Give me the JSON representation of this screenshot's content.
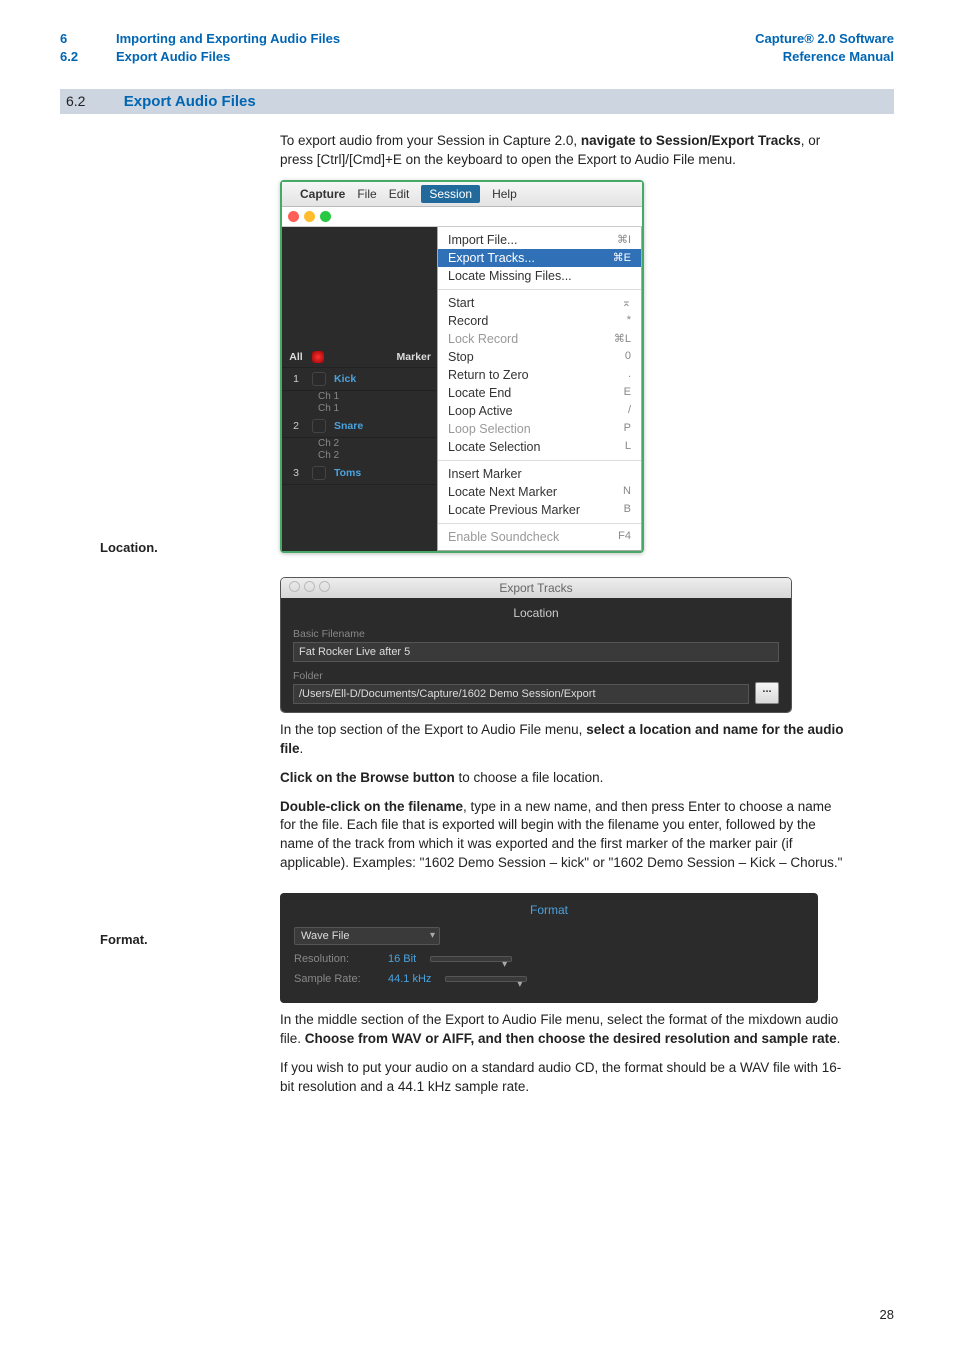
{
  "header": {
    "left_num1": "6",
    "left_title1": "Importing and Exporting Audio Files",
    "left_num2": "6.2",
    "left_title2": "Export Audio Files",
    "right1": "Capture® 2.0 Software",
    "right2": "Reference Manual"
  },
  "section": {
    "num": "6.2",
    "title": "Export Audio Files"
  },
  "intro": {
    "part1": "To export audio from your Session in Capture 2.0, ",
    "bold1": "navigate to Session/Export Tracks",
    "part2": ", or press [Ctrl]/[Cmd]+E on the keyboard to open the Export to Audio File menu."
  },
  "menu": {
    "menubar": {
      "apple": "",
      "app": "Capture",
      "file": "File",
      "edit": "Edit",
      "session": "Session",
      "help": "Help"
    },
    "tracks": {
      "allLabel": "All",
      "markerLabel": "Marker",
      "rows": [
        {
          "num": "1",
          "name": "Kick",
          "subA": "Ch 1",
          "subB": "Ch 1"
        },
        {
          "num": "2",
          "name": "Snare",
          "subA": "Ch 2",
          "subB": "Ch 2"
        },
        {
          "num": "3",
          "name": "Toms"
        }
      ]
    },
    "items": [
      {
        "label": "Import File...",
        "kb": "⌘I"
      },
      {
        "label": "Export Tracks...",
        "kb": "⌘E",
        "hl": true
      },
      {
        "label": "Locate Missing Files...",
        "kb": ""
      },
      {
        "sep": true
      },
      {
        "label": "Start",
        "kb": "⌅"
      },
      {
        "label": "Record",
        "kb": "*"
      },
      {
        "label": "Lock Record",
        "kb": "⌘L",
        "disabled": true
      },
      {
        "label": "Stop",
        "kb": "0"
      },
      {
        "label": "Return to Zero",
        "kb": "."
      },
      {
        "label": "Locate End",
        "kb": "E"
      },
      {
        "label": "Loop Active",
        "kb": "/"
      },
      {
        "label": "Loop Selection",
        "kb": "P",
        "disabled": true
      },
      {
        "label": "Locate Selection",
        "kb": "L"
      },
      {
        "sep": true
      },
      {
        "label": "Insert Marker",
        "kb": ""
      },
      {
        "label": "Locate Next Marker",
        "kb": "N"
      },
      {
        "label": "Locate Previous Marker",
        "kb": "B"
      },
      {
        "sep": true
      },
      {
        "label": "Enable Soundcheck",
        "kb": "F4",
        "disabled": true
      }
    ]
  },
  "side_location": "Location.",
  "loc_panel": {
    "wintitle": "Export Tracks",
    "heading": "Location",
    "basic_lbl": "Basic Filename",
    "basic_val": "Fat Rocker Live after 5",
    "folder_lbl": "Folder",
    "folder_val": "/Users/Ell-D/Documents/Capture/1602 Demo Session/Export",
    "browse": "..."
  },
  "loc_text": {
    "p1a": "In the top section of the Export to Audio File menu, ",
    "p1b": "select a location and name for the audio file",
    "p1c": ".",
    "p2a": "Click on the Browse button",
    "p2b": " to choose a file location.",
    "p3a": "Double-click on the filename",
    "p3b": ", type in a new name, and then press Enter to choose a name for the file. Each file that is exported will begin with the filename you enter, followed by the name of the track from which it was exported and the first marker of the marker pair (if applicable). Examples: \"1602 Demo Session – kick\" or \"1602 Demo Session – Kick – Chorus.\""
  },
  "side_format": "Format.",
  "fmt_panel": {
    "heading": "Format",
    "file_type": "Wave File",
    "res_lbl": "Resolution:",
    "res_val": "16 Bit",
    "rate_lbl": "Sample Rate:",
    "rate_val": "44.1 kHz"
  },
  "fmt_text": {
    "p1a": "In the middle section of the Export to Audio File menu, select the format of the mixdown audio file. ",
    "p1b": "Choose from WAV or AIFF, and then choose the desired resolution and sample rate",
    "p1c": ".",
    "p2": "If you wish to put your audio on a standard audio CD, the format should be a WAV file with 16-bit resolution and a 44.1 kHz sample rate."
  },
  "page_num": "28"
}
